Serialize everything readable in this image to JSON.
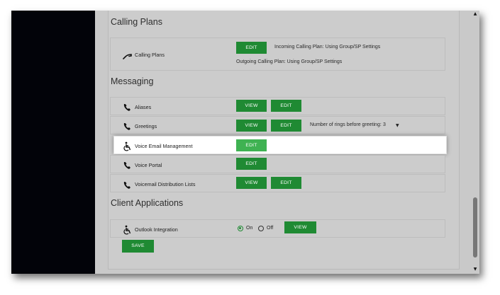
{
  "sections": {
    "calling_plans": "Calling Plans",
    "messaging": "Messaging",
    "client_applications": "Client Applications"
  },
  "calling_plans_row": {
    "label": "Calling Plans",
    "edit": "EDIT",
    "incoming": "Incoming Calling Plan: Using Group/SP Settings",
    "outgoing": "Outgoing Calling Plan: Using Group/SP Settings"
  },
  "messaging_rows": [
    {
      "label": "Aliases",
      "view": "VIEW",
      "edit": "EDIT"
    },
    {
      "label": "Greetings",
      "view": "VIEW",
      "edit": "EDIT",
      "rings_label": "Number of rings before greeting:",
      "rings_value": "3"
    },
    {
      "label": "Voice Email Management",
      "edit": "EDIT"
    },
    {
      "label": "Voice Portal",
      "edit": "EDIT"
    },
    {
      "label": "Voicemail Distribution Lists",
      "view": "VIEW",
      "edit": "EDIT"
    }
  ],
  "client_rows": [
    {
      "label": "Outlook Integration",
      "on_label": "On",
      "off_label": "Off",
      "selected": "On",
      "view": "VIEW"
    }
  ],
  "save_label": "SAVE",
  "icons": {
    "phone": "phone-handset-icon",
    "accessibility": "accessibility-icon",
    "dropdown": "caret-down-icon",
    "scroll_up": "scroll-up-arrow",
    "scroll_down": "scroll-down-arrow"
  },
  "colors": {
    "button_green": "#1f8a33",
    "button_green_light": "#3fb252",
    "panel_dark": "#020309",
    "background_gray": "#cccccc"
  }
}
